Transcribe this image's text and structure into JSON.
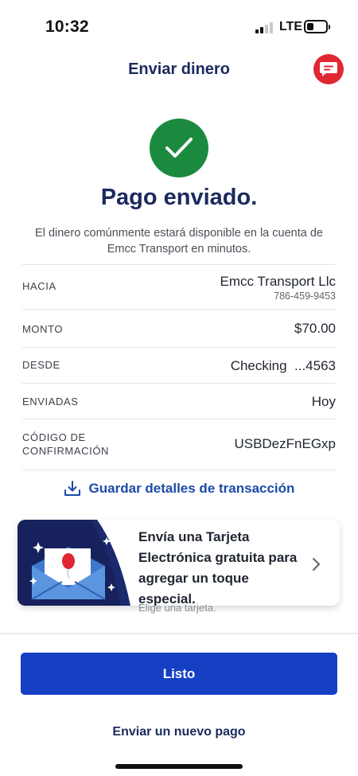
{
  "status_bar": {
    "time": "10:32",
    "network": "LTE"
  },
  "header": {
    "title": "Enviar dinero"
  },
  "confirmation": {
    "title": "Pago enviado.",
    "message": "El dinero comúnmente estará disponible en la cuenta de Emcc Transport en minutos."
  },
  "details": {
    "to_label": "HACIA",
    "to_name": "Emcc Transport Llc",
    "to_phone": "786-459-9453",
    "amount_label": "MONTO",
    "amount_value": "$70.00",
    "from_label": "DESDE",
    "from_value": "Checking  ...4563",
    "sent_label": "ENVIADAS",
    "sent_value": "Hoy",
    "code_label_line1": "CÓDIGO DE",
    "code_label_line2": "CONFIRMACIÓN",
    "code_value": "USBDezFnEGxp"
  },
  "save_link": {
    "label": "Guardar detalles de transacción"
  },
  "promo": {
    "text": "Envía una Tarjeta Electrónica gratuita para agregar un toque especial.",
    "cta": "Elige una tarjeta."
  },
  "actions": {
    "done_label": "Listo",
    "new_payment_label": "Enviar un nuevo pago"
  },
  "colors": {
    "navy": "#1b2a5e",
    "primary_blue": "#1540c4",
    "success_green": "#1c8a3e",
    "chat_red": "#e02631"
  },
  "icons": {
    "chat": "chat-bubble-icon",
    "success": "checkmark-icon",
    "download": "download-icon",
    "chevron": "chevron-right-icon"
  }
}
